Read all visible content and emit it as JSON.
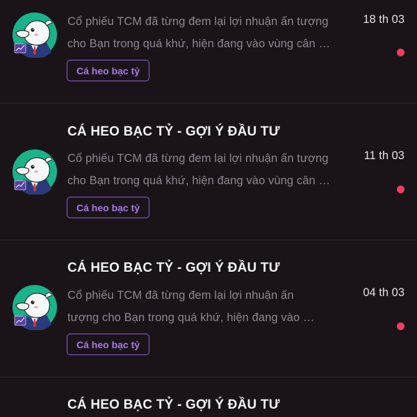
{
  "colors": {
    "background": "#1a1419",
    "tag_accent": "#8f5dd6",
    "unread_dot": "#f03e62",
    "avatar_bg": "#1bb389"
  },
  "notifications": [
    {
      "title": "",
      "preview_line1": "Cổ phiếu TCM đã từng đem lại lợi nhuận ấn tượng",
      "preview_line2": "cho Bạn trong quá khứ, hiện đang vào vùng cân …",
      "tag": "Cá heo bạc tỷ",
      "date": "18 th 03",
      "avatar_icon": "dolphin-mascot-icon",
      "unread": true
    },
    {
      "title": "CÁ HEO BẠC TỶ - GỢI Ý ĐẦU TƯ",
      "preview_line1": "Cổ phiếu TCM đã từng đem lại lợi nhuận ấn tượng",
      "preview_line2": "cho Bạn trong quá khứ, hiện đang vào vùng cân …",
      "tag": "Cá heo bạc tỷ",
      "date": "11 th 03",
      "avatar_icon": "dolphin-mascot-icon",
      "unread": true
    },
    {
      "title": "CÁ HEO BẠC TỶ - GỢI Ý ĐẦU TƯ",
      "preview_line1": "Cổ phiếu TCM đã từng đem lại lợi nhuận ấn",
      "preview_line2": "tượng cho Bạn trong quá khứ, hiện đang vào …",
      "tag": "Cá heo bạc tỷ",
      "date": "04 th 03",
      "avatar_icon": "dolphin-mascot-icon",
      "unread": true
    },
    {
      "title": "CÁ HEO BẠC TỶ - GỢI Ý ĐẦU TƯ"
    }
  ]
}
